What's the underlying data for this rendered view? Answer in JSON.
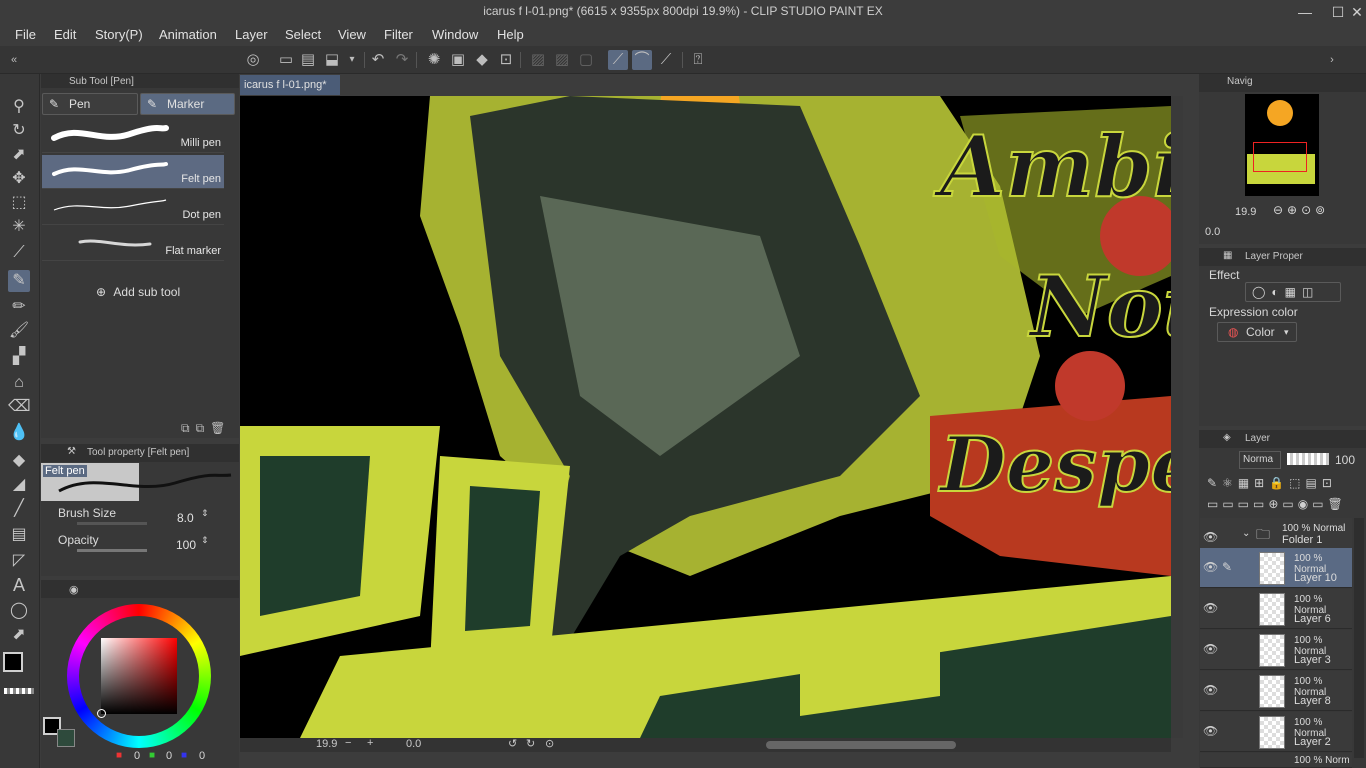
{
  "app": {
    "window_title": "icarus f l-01.png* (6615 x 9355px 800dpi 19.9%)  - CLIP STUDIO PAINT EX"
  },
  "window_controls": {
    "minimize": "—",
    "maximize": "☐",
    "close": "✕"
  },
  "menu": [
    "File",
    "Edit",
    "Story(P)",
    "Animation",
    "Layer",
    "Select",
    "View",
    "Filter",
    "Window",
    "Help"
  ],
  "sub_tool": {
    "header": "Sub Tool [Pen]",
    "tabs": [
      "Pen",
      "Marker"
    ],
    "brushes": [
      "Milli pen",
      "Felt pen",
      "Dot pen",
      "Flat marker"
    ],
    "selected_brush": "Felt pen",
    "add_label": "Add sub tool"
  },
  "tool_property": {
    "header": "Tool property [Felt pen]",
    "preview_label": "Felt pen",
    "brush_size_label": "Brush Size",
    "brush_size_value": "8.0",
    "opacity_label": "Opacity",
    "opacity_value": "100"
  },
  "color": {
    "main_color": "#000000",
    "sub_color": "#2e4a3c",
    "r": "0",
    "g": "0",
    "b": "0"
  },
  "document": {
    "tab_label": "icarus f l-01.png*"
  },
  "canvas_text": {
    "line1": "Ambiti",
    "line2": "Not",
    "line3": "Desper"
  },
  "status": {
    "zoom": "19.9",
    "angle": "0.0"
  },
  "navigator": {
    "tab": "Navig",
    "zoom": "19.9",
    "angle": "0.0"
  },
  "layer_property": {
    "tab": "Layer Proper",
    "effect_label": "Effect",
    "expression_label": "Expression color",
    "expression_value": "Color"
  },
  "layer_panel": {
    "tab": "Layer",
    "blend_mode": "Norma",
    "opacity": "100",
    "folder": {
      "mode": "100 % Normal",
      "name": "Folder 1"
    },
    "layers": [
      {
        "mode": "100 % Normal",
        "name": "Layer 10"
      },
      {
        "mode": "100 % Normal",
        "name": "Layer 6"
      },
      {
        "mode": "100 % Normal",
        "name": "Layer 3"
      },
      {
        "mode": "100 % Normal",
        "name": "Layer 8"
      },
      {
        "mode": "100 % Normal",
        "name": "Layer 2"
      }
    ],
    "bottom_partial": "100 % Norm"
  },
  "colors": {
    "accent_selection": "#5b6a82",
    "canvas_lime": "#c9d62a",
    "canvas_red": "#c0392b",
    "canvas_dark": "#1e3a2a"
  }
}
